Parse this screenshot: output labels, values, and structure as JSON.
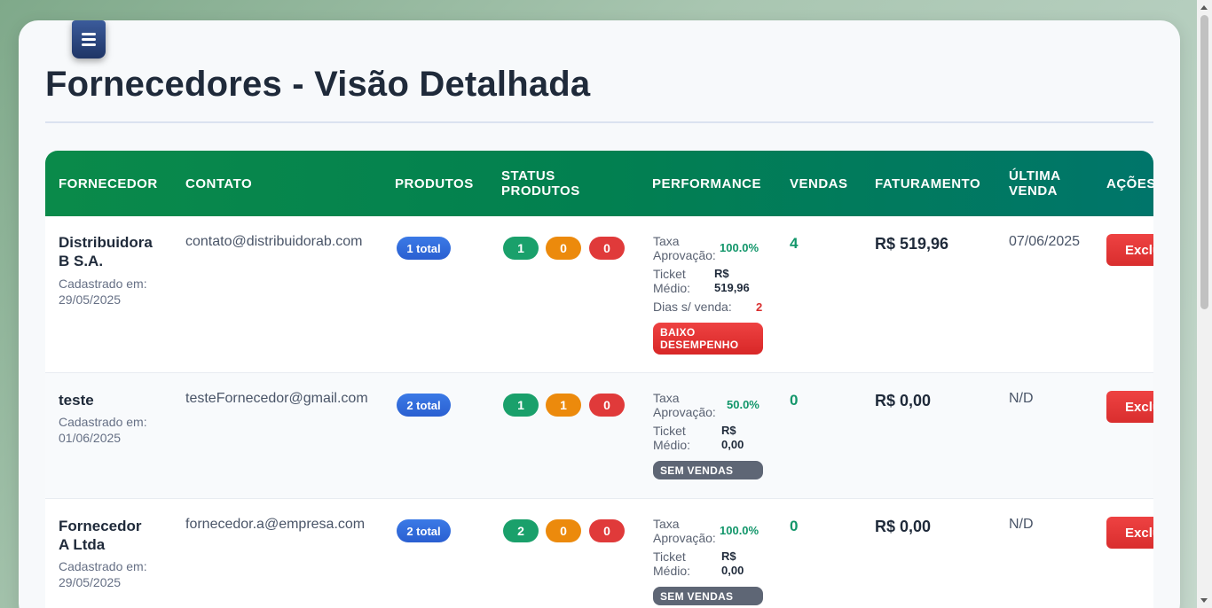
{
  "page": {
    "title": "Fornecedores - Visão Detalhada"
  },
  "table": {
    "headers": {
      "fornecedor": "FORNECEDOR",
      "contato": "CONTATO",
      "produtos": "PRODUTOS",
      "status_l1": "STATUS",
      "status_l2": "PRODUTOS",
      "performance": "PERFORMANCE",
      "vendas": "VENDAS",
      "faturamento": "FATURAMENTO",
      "ultima_l1": "ÚLTIMA",
      "ultima_l2": "VENDA",
      "acoes": "AÇÕES"
    },
    "labels": {
      "cadastrado": "Cadastrado em:",
      "taxa_l1": "Taxa",
      "taxa_l2": "Aprovação:",
      "ticket_l1": "Ticket",
      "ticket_l2": "Médio:",
      "dias": "Dias s/ venda:",
      "delete_button": "Excluir"
    },
    "rows": [
      {
        "name_l1": "Distribuidora",
        "name_l2": "B S.A.",
        "registered": "29/05/2025",
        "email": "contato@distribuidorab.com",
        "products_total": "1 total",
        "status_active": "1",
        "status_pending": "0",
        "status_inactive": "0",
        "approval_rate": "100.0%",
        "ticket_l1": "R$",
        "ticket_l2": "519,96",
        "days_without_sale": "2",
        "badge_l1": "BAIXO",
        "badge_l2": "DESEMPENHO",
        "sales": "4",
        "revenue": "R$ 519,96",
        "last_sale": "07/06/2025"
      },
      {
        "name": "teste",
        "registered": "01/06/2025",
        "email": "testeFornecedor@gmail.com",
        "products_total": "2 total",
        "status_active": "1",
        "status_pending": "1",
        "status_inactive": "0",
        "approval_rate": "50.0%",
        "ticket_l1": "R$",
        "ticket_l2": "0,00",
        "badge": "SEM VENDAS",
        "sales": "0",
        "revenue": "R$ 0,00",
        "last_sale": "N/D"
      },
      {
        "name_l1": "Fornecedor",
        "name_l2": "A Ltda",
        "registered": "29/05/2025",
        "email": "fornecedor.a@empresa.com",
        "products_total": "2 total",
        "status_active": "2",
        "status_pending": "0",
        "status_inactive": "0",
        "approval_rate": "100.0%",
        "ticket_l1": "R$",
        "ticket_l2": "0,00",
        "badge": "SEM VENDAS",
        "sales": "0",
        "revenue": "R$ 0,00",
        "last_sale": "N/D"
      }
    ]
  },
  "colors": {
    "header_gradient_start": "#0a8a4a",
    "header_gradient_end": "#00756a",
    "accent_green": "#12966a",
    "danger_red": "#e03a3a",
    "warning_orange": "#ec8a0c",
    "primary_blue": "#2a5fd1"
  }
}
